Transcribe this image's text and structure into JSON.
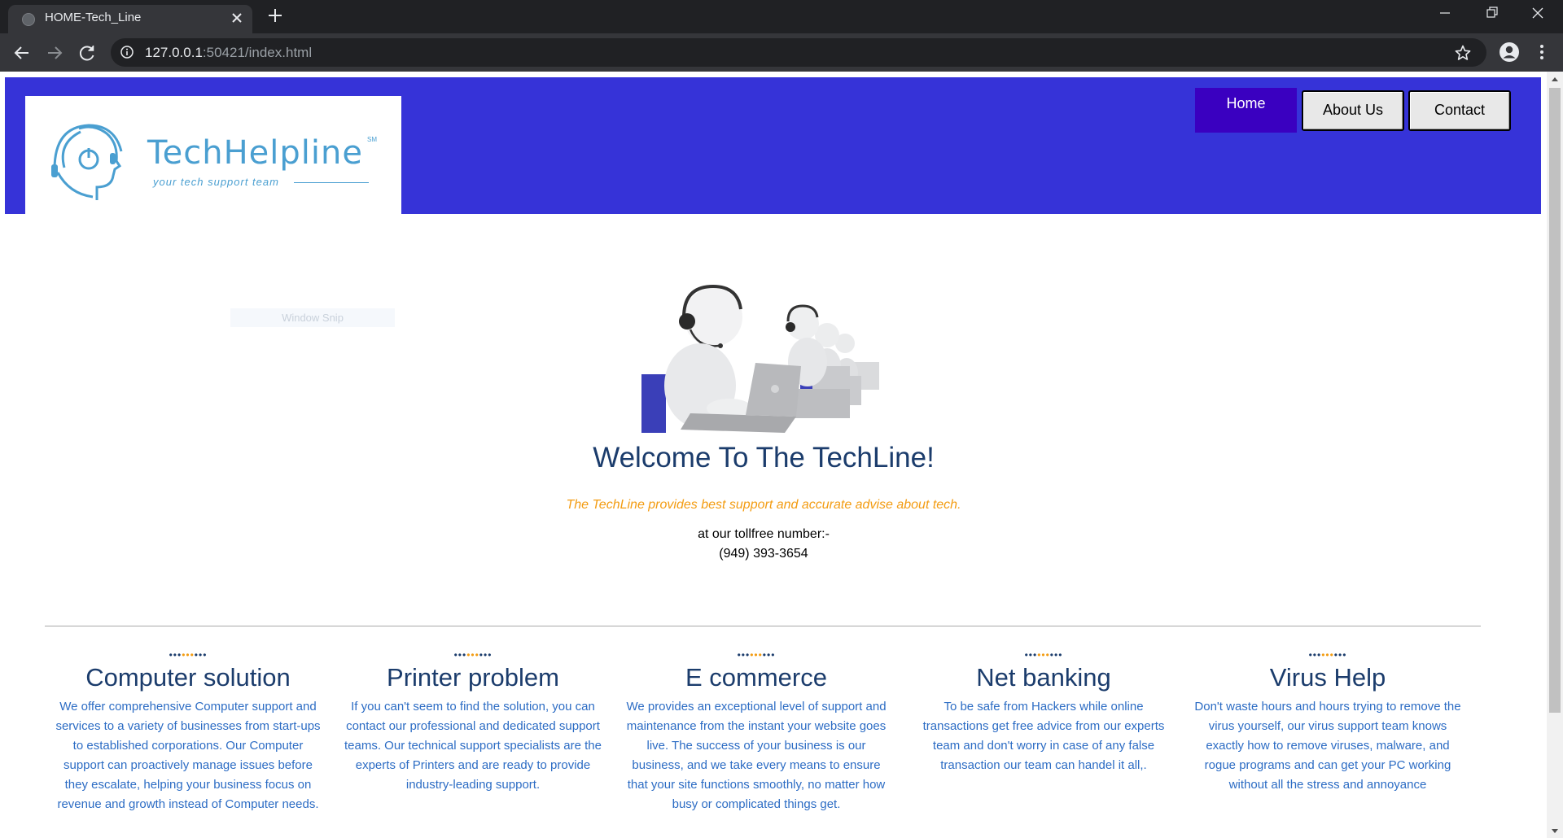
{
  "browser": {
    "tab_title": "HOME-Tech_Line",
    "url_host": "127.0.0.1",
    "url_rest": ":50421/index.html"
  },
  "header": {
    "logo_name": "TechHelpline",
    "logo_mark": "SM",
    "logo_tagline": "your tech support team",
    "nav": {
      "home": "Home",
      "about": "About Us",
      "contact": "Contact"
    },
    "colors": {
      "header_bg": "#3633d8",
      "active_nav_bg": "#3a00c0"
    }
  },
  "overlay": {
    "snip_label": "Window Snip"
  },
  "hero": {
    "heading": "Welcome To The TechLine!",
    "tagline": "The TechLine provides best support and accurate advise about tech.",
    "tollfree_label": "at our tollfree number:-",
    "tollfree_number": "(949) 393-3654"
  },
  "services": [
    {
      "title": "Computer solution",
      "body": "We offer comprehensive Computer support and services to a variety of businesses from start-ups to established corporations. Our Computer support can proactively manage issues before they escalate, helping your business focus on revenue and growth instead of Computer needs."
    },
    {
      "title": "Printer problem",
      "body": "If you can't seem to find the solution, you can contact our professional and dedicated support teams. Our technical support specialists are the experts of Printers and are ready to provide industry-leading support."
    },
    {
      "title": "E commerce",
      "body": "We provides an exceptional level of support and maintenance from the instant your website goes live. The success of your business is our business, and we take every means to ensure that your site functions smoothly, no matter how busy or complicated things get."
    },
    {
      "title": "Net banking",
      "body": "To be safe from Hackers while online transactions get free advice from our experts team and don't worry in case of any false transaction our team can handel it all,."
    },
    {
      "title": "Virus Help",
      "body": "Don't waste hours and hours trying to remove the virus yourself, our virus support team knows exactly how to remove viruses, malware, and rogue programs and can get your PC working without all the stress and annoyance"
    }
  ]
}
